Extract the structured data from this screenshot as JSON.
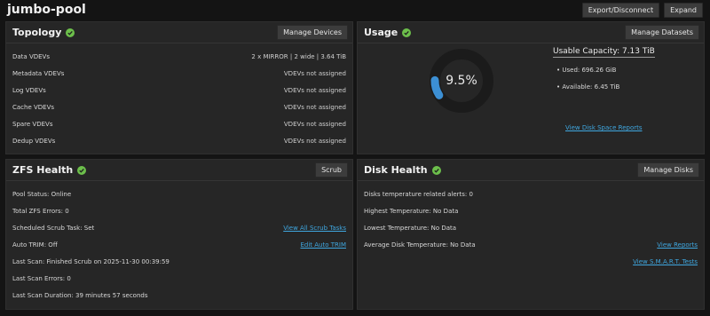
{
  "pool": {
    "name": "jumbo-pool",
    "export_label": "Export/Disconnect",
    "expand_label": "Expand"
  },
  "topology": {
    "title": "Topology",
    "button_label": "Manage Devices",
    "rows": [
      {
        "label": "Data VDEVs",
        "value": "2 x MIRROR | 2 wide | 3.64 TiB"
      },
      {
        "label": "Metadata VDEVs",
        "value": "VDEVs not assigned"
      },
      {
        "label": "Log VDEVs",
        "value": "VDEVs not assigned"
      },
      {
        "label": "Cache VDEVs",
        "value": "VDEVs not assigned"
      },
      {
        "label": "Spare VDEVs",
        "value": "VDEVs not assigned"
      },
      {
        "label": "Dedup VDEVs",
        "value": "VDEVs not assigned"
      }
    ]
  },
  "usage": {
    "title": "Usage",
    "button_label": "Manage Datasets",
    "percent_text": "9.5%",
    "used_fraction": 0.095,
    "usable_capacity": "Usable Capacity: 7.13 TiB",
    "used": "Used: 696.26 GiB",
    "available": "Available: 6.45 TiB",
    "report_link": "View Disk Space Reports",
    "colors": {
      "used": "#3c8fd4",
      "track": "#1b1b1b"
    }
  },
  "zfs_health": {
    "title": "ZFS Health",
    "button_label": "Scrub",
    "pool_status": "Pool Status: Online",
    "total_errors": "Total ZFS Errors: 0",
    "scheduled_scrub": "Scheduled Scrub Task: Set",
    "scrub_link": "View All Scrub Tasks",
    "auto_trim": "Auto TRIM: Off",
    "trim_link": "Edit Auto TRIM",
    "last_scan": "Last Scan: Finished Scrub on 2025-11-30 00:39:59",
    "last_scan_errors": "Last Scan Errors: 0",
    "last_scan_duration": "Last Scan Duration: 39 minutes 57 seconds"
  },
  "disk_health": {
    "title": "Disk Health",
    "button_label": "Manage Disks",
    "temp_alerts": "Disks temperature related alerts: 0",
    "highest_temp": "Highest Temperature: No Data",
    "lowest_temp": "Lowest Temperature: No Data",
    "avg_temp": "Average Disk Temperature: No Data",
    "reports_link": "View Reports",
    "smart_link": "View S.M.A.R.T. Tests"
  },
  "colors": {
    "healthy_check": "#6cbf4b",
    "link": "#3fa7e0",
    "background": "#141414",
    "card": "#262626"
  }
}
